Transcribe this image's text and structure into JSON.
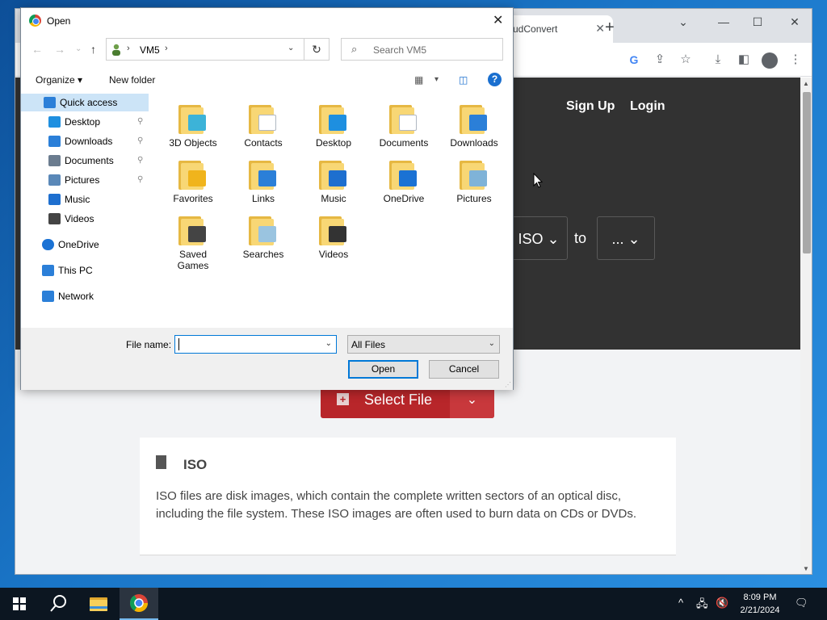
{
  "browser": {
    "tab_title": "udConvert",
    "tab_close": "✕",
    "new_tab": "+",
    "window_controls": {
      "minimize": "—",
      "maximize": "☐",
      "close": "✕",
      "tab_search": "⌄"
    },
    "toolbar_icons": [
      "google-icon",
      "share-icon",
      "star-icon",
      "download-icon",
      "sidebar-icon",
      "profile-icon",
      "menu-icon"
    ]
  },
  "website": {
    "nav": {
      "signup": "Sign Up",
      "login": "Login"
    },
    "converter": {
      "from": "ISO ⌄",
      "to_label": "to",
      "target": "... ⌄"
    },
    "select_file": {
      "plus": "+",
      "label": "Select File",
      "dropdown": "⌄"
    },
    "info": {
      "title": "ISO",
      "text": "ISO files are disk images, which contain the complete written sectors of an optical disc, including the file system. These ISO images are often used to burn data on CDs or DVDs."
    }
  },
  "dialog": {
    "title": "Open",
    "close": "✕",
    "address": {
      "separator": "›",
      "path": "VM5",
      "dropdown": "⌄",
      "refresh": "↻"
    },
    "nav_arrows": {
      "back": "←",
      "forward": "→",
      "recent": "⌄",
      "up": "↑"
    },
    "search": {
      "icon": "⌕",
      "placeholder": "Search VM5"
    },
    "commands": {
      "organize": "Organize ▾",
      "new_folder": "New folder",
      "view_dd": "▾"
    },
    "help": "?",
    "nav_pane": [
      {
        "label": "Quick access",
        "icon": "star-icon",
        "selected": true,
        "pinned": false
      },
      {
        "label": "Desktop",
        "icon": "desktop-icon",
        "pinned": true
      },
      {
        "label": "Downloads",
        "icon": "download-icon",
        "pinned": true
      },
      {
        "label": "Documents",
        "icon": "document-icon",
        "pinned": true
      },
      {
        "label": "Pictures",
        "icon": "picture-icon",
        "pinned": true
      },
      {
        "label": "Music",
        "icon": "music-icon",
        "pinned": false
      },
      {
        "label": "Videos",
        "icon": "video-icon",
        "pinned": false
      },
      {
        "label": "OneDrive",
        "icon": "cloud-icon",
        "pinned": false
      },
      {
        "label": "This PC",
        "icon": "computer-icon",
        "pinned": false
      },
      {
        "label": "Network",
        "icon": "network-icon",
        "pinned": false
      }
    ],
    "pin_glyph": "📌",
    "folders": [
      {
        "label": "3D Objects",
        "icon": "cube-icon",
        "emblem_color": "#3cb3d8"
      },
      {
        "label": "Contacts",
        "icon": "contact-card-icon",
        "emblem_color": "#ffffff"
      },
      {
        "label": "Desktop",
        "icon": "monitor-icon",
        "emblem_color": "#1e8fe0"
      },
      {
        "label": "Documents",
        "icon": "document-icon",
        "emblem_color": "#ffffff"
      },
      {
        "label": "Downloads",
        "icon": "down-arrow-icon",
        "emblem_color": "#2b7fd8"
      },
      {
        "label": "Favorites",
        "icon": "star-icon",
        "emblem_color": "#f0b41c"
      },
      {
        "label": "Links",
        "icon": "link-arrow-icon",
        "emblem_color": "#2b7fd8"
      },
      {
        "label": "Music",
        "icon": "music-note-icon",
        "emblem_color": "#1e6fcf"
      },
      {
        "label": "OneDrive",
        "icon": "cloud-icon",
        "emblem_color": "#1b72d4"
      },
      {
        "label": "Pictures",
        "icon": "landscape-icon",
        "emblem_color": "#7fb3d8"
      },
      {
        "label": "Saved Games",
        "icon": "chess-piece-icon",
        "emblem_color": "#444444"
      },
      {
        "label": "Searches",
        "icon": "magnifier-icon",
        "emblem_color": "#9ac4e0"
      },
      {
        "label": "Videos",
        "icon": "film-strip-icon",
        "emblem_color": "#333333"
      }
    ],
    "file_name_label": "File name:",
    "file_name_value": "",
    "file_type": "All Files",
    "file_type_dd": "⌄",
    "open_button": "Open",
    "cancel_button": "Cancel"
  },
  "taskbar": {
    "clock_time": "8:09 PM",
    "clock_date": "2/21/2024",
    "tray": {
      "chevron": "^",
      "network": "🖧",
      "volume": "🔇",
      "notifications": "🗨"
    }
  }
}
